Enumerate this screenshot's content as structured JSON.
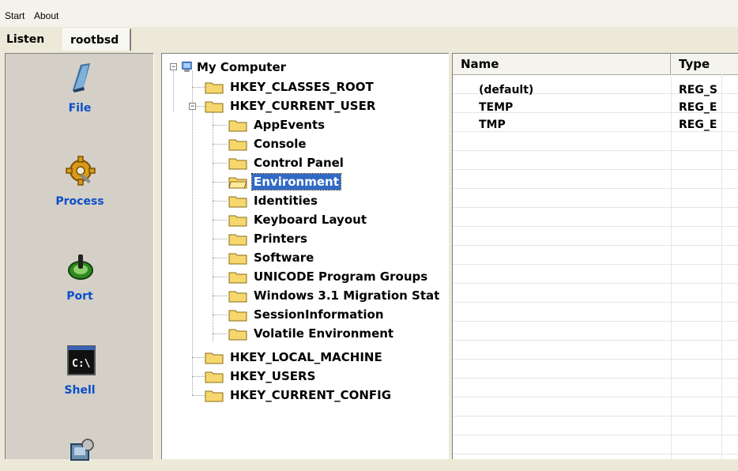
{
  "menu": {
    "start": "Start",
    "about": "About"
  },
  "tabs": {
    "listen": "Listen",
    "rootbsd": "rootbsd"
  },
  "nav": [
    {
      "label": "File",
      "icon": "file-icon"
    },
    {
      "label": "Process",
      "icon": "process-gear-icon"
    },
    {
      "label": "Port",
      "icon": "port-power-icon"
    },
    {
      "label": "Shell",
      "icon": "shell-console-icon"
    },
    {
      "label": "",
      "icon": "network-icon"
    }
  ],
  "tree": {
    "root": "My Computer",
    "hives": [
      "HKEY_CLASSES_ROOT",
      "HKEY_CURRENT_USER",
      "HKEY_LOCAL_MACHINE",
      "HKEY_USERS",
      "HKEY_CURRENT_CONFIG"
    ],
    "current_user_children": [
      "AppEvents",
      "Console",
      "Control Panel",
      "Environment",
      "Identities",
      "Keyboard Layout",
      "Printers",
      "Software",
      "UNICODE Program Groups",
      "Windows 3.1 Migration Stat",
      "SessionInformation",
      "Volatile Environment"
    ],
    "selected": "Environment"
  },
  "list": {
    "columns": [
      "Name",
      "Type"
    ],
    "rows": [
      {
        "name": "(default)",
        "type": "REG_S"
      },
      {
        "name": "TEMP",
        "type": "REG_E"
      },
      {
        "name": "TMP",
        "type": "REG_E"
      }
    ]
  },
  "colors": {
    "accent": "#0b4ec9",
    "selection": "#316ac5",
    "folder": "#f5d76e"
  }
}
